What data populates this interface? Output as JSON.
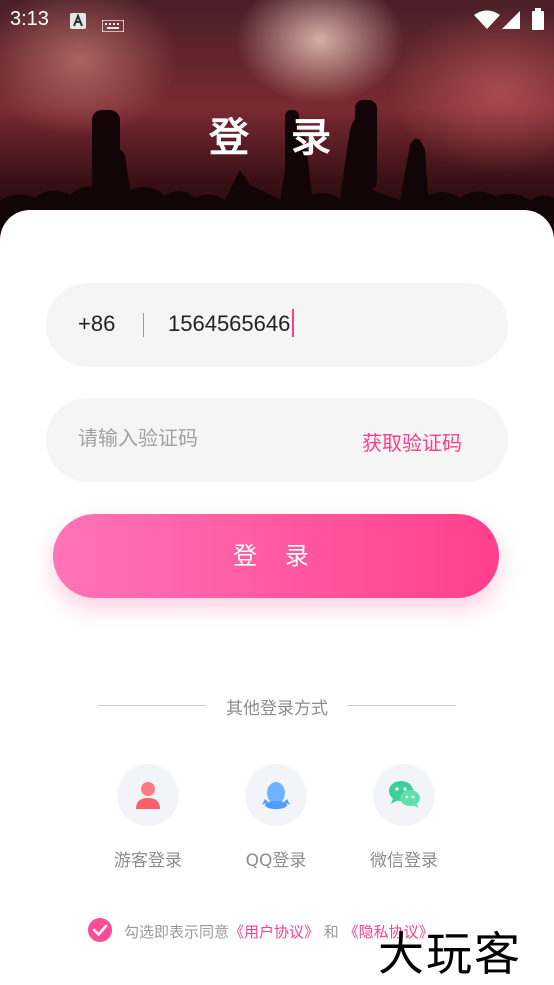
{
  "status_bar": {
    "time": "3:13",
    "icons": [
      "notification-a-icon",
      "keyboard-icon",
      "wifi-icon",
      "signal-icon",
      "battery-icon"
    ]
  },
  "header": {
    "title": "登 录"
  },
  "phone_field": {
    "country_code": "+86",
    "value": "1564565646"
  },
  "code_field": {
    "placeholder": "请输入验证码",
    "get_code_label": "获取验证码"
  },
  "login_button": {
    "label": "登 录"
  },
  "other_login": {
    "title": "其他登录方式",
    "methods": [
      {
        "label": "游客登录",
        "icon": "guest-user-icon"
      },
      {
        "label": "QQ登录",
        "icon": "qq-penguin-icon"
      },
      {
        "label": "微信登录",
        "icon": "wechat-icon"
      }
    ]
  },
  "agreement": {
    "prefix": "勾选即表示同意",
    "user_agreement": "《用户协议》",
    "and": " 和 ",
    "privacy_agreement": "《隐私协议》",
    "checked": true
  },
  "watermark": {
    "text": "大玩客"
  },
  "colors": {
    "accent": "#ff3d8a",
    "button_start": "#ff74b6",
    "button_end": "#ff3f8c",
    "field_bg": "#f5f5f5",
    "muted_text": "#8c8c8c"
  }
}
